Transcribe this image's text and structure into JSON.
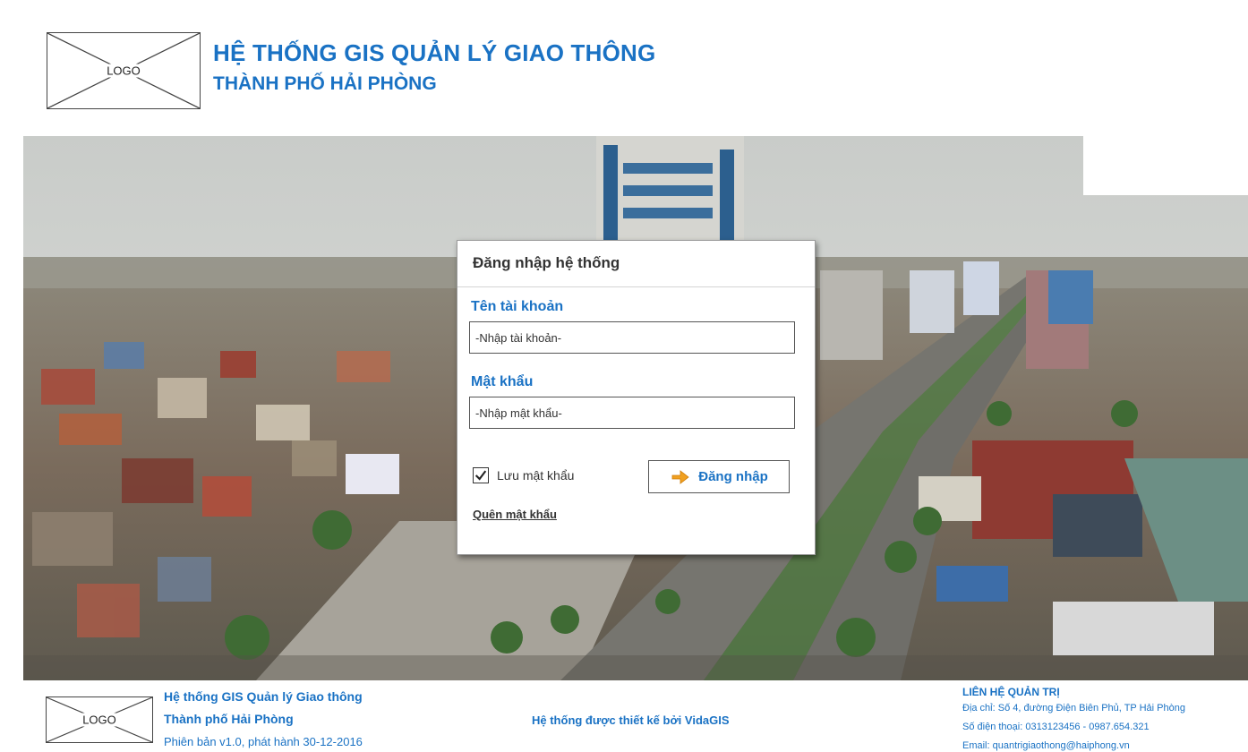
{
  "header": {
    "logo_text": "LOGO",
    "title": "HỆ THỐNG GIS QUẢN LÝ GIAO THÔNG",
    "subtitle": "THÀNH PHỐ HẢI PHÒNG"
  },
  "login": {
    "title": "Đăng nhập hệ thống",
    "username_label": "Tên tài khoản",
    "username_placeholder": "-Nhập tài khoản-",
    "password_label": "Mật khẩu",
    "password_placeholder": "-Nhập mật khẩu-",
    "remember_label": "Lưu mật khẩu",
    "remember_checked": true,
    "submit_label": "Đăng nhập",
    "forgot_label": "Quên mật khẩu"
  },
  "footer": {
    "logo_text": "LOGO",
    "system_line1": "Hệ thống GIS Quản lý Giao thông",
    "system_line2": "Thành phố Hải Phòng",
    "version": "Phiên bản v1.0, phát hành 30-12-2016",
    "designed_by": "Hệ thống được thiết kế bởi VidaGIS",
    "contact_title": "LIÊN HỆ QUẢN TRỊ",
    "contact_address": "Địa chỉ: Số 4, đường Điện Biên Phủ, TP Hải Phòng",
    "contact_phone": "Số điện thoại: 0313123456 - 0987.654.321",
    "contact_email": "Email: quantrigiaothong@haiphong.vn"
  },
  "colors": {
    "accent": "#1a72c4",
    "arrow": "#f0a020"
  },
  "icons": {
    "login_button": "arrow-right-icon",
    "remember": "checkmark-icon"
  }
}
